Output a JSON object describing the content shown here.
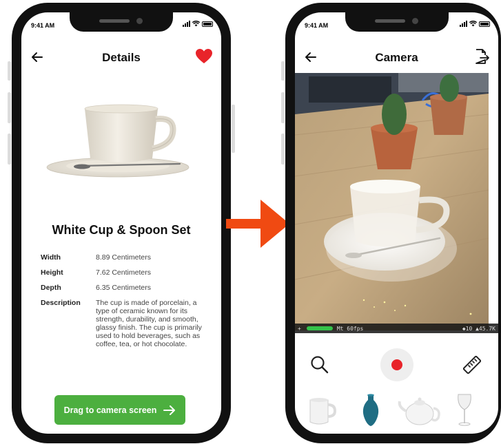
{
  "status": {
    "time_left": "9:41 AM",
    "time_right": "9:41 AM"
  },
  "details_screen": {
    "title": "Details",
    "product_title": "White Cup & Spoon Set",
    "specs": [
      {
        "label": "Width",
        "value": "8.89 Centimeters"
      },
      {
        "label": "Height",
        "value": "7.62 Centimeters"
      },
      {
        "label": "Depth",
        "value": "6.35 Centimeters"
      },
      {
        "label": "Description",
        "value": "The cup is made of porcelain, a type of ceramic known for its strength, durability, and smooth, glassy finish. The cup is primarily used to hold beverages, such as coffee, tea, or hot chocolate."
      }
    ],
    "drag_button_label": "Drag to camera screen",
    "favorite_color": "#e8242a"
  },
  "camera_screen": {
    "title": "Camera",
    "hud": {
      "left": "+",
      "fps": "Mt 60fps",
      "right": "◆10 ▲45.7K"
    },
    "thumbnails": [
      "mug-icon",
      "vase-icon",
      "teapot-icon",
      "wine-glass-icon"
    ],
    "record_color": "#e8242a"
  },
  "colors": {
    "accent_green": "#4caf3f",
    "arrow": "#f04a12"
  }
}
